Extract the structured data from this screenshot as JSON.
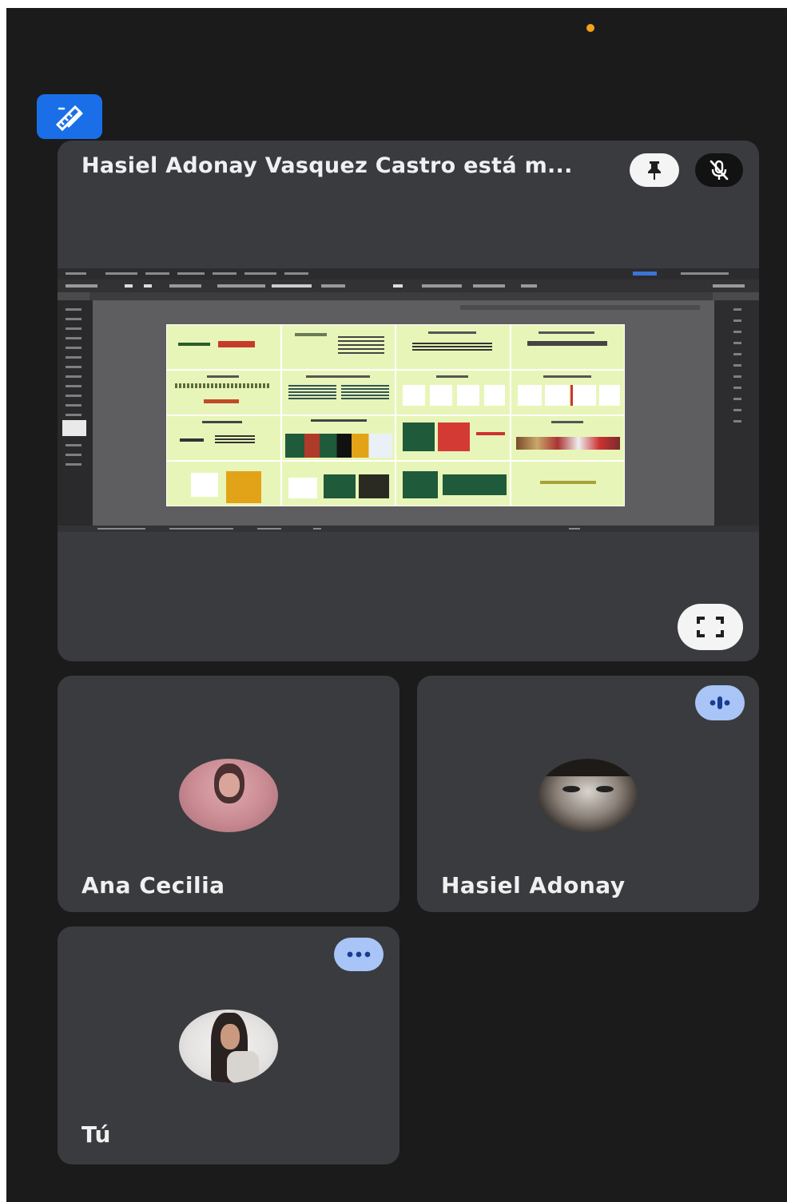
{
  "app": {
    "status_dot_color": "#f2a31a",
    "whiteboard_icon": "pencil-ruler-icon"
  },
  "main_tile": {
    "title": "Hasiel Adonay Vasquez Castro está m...",
    "pin_icon": "pin-icon",
    "mic_icon": "mic-off-icon",
    "fullscreen_icon": "fullscreen-icon",
    "shared_content": {
      "app": "vector design editor",
      "artboard_color": "#e8f5b8"
    }
  },
  "participants": [
    {
      "name": "Ana Cecilia",
      "avatar_tone": "#c98a92"
    },
    {
      "name": "Hasiel Adonay",
      "avatar_tone": "#3a3430",
      "badge_icon": "speaking-icon"
    },
    {
      "name": "Tú",
      "avatar_tone": "#e4e2e0",
      "badge_icon": "more-options-icon"
    }
  ]
}
